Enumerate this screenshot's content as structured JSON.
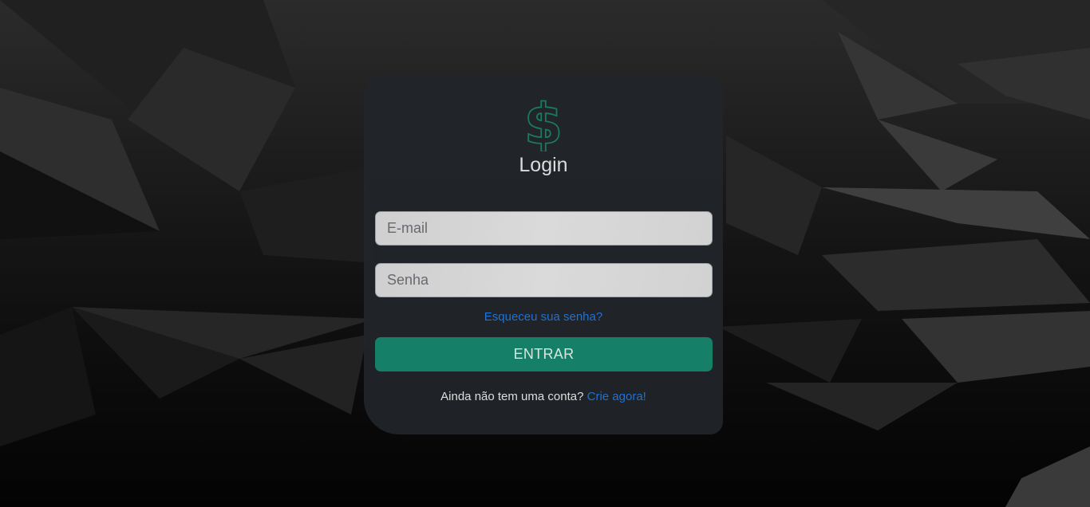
{
  "login": {
    "logo_icon": "dollar-sign-icon",
    "title": "Login",
    "email_placeholder": "E-mail",
    "password_placeholder": "Senha",
    "forgot_link": "Esqueceu sua senha?",
    "submit_label": "ENTRAR",
    "signup_prompt": "Ainda não tem uma conta?",
    "signup_link": "Crie agora!"
  },
  "colors": {
    "accent": "#157f68",
    "logo": "#1a7a5e",
    "link": "#1f72d6",
    "card": "#212529"
  }
}
